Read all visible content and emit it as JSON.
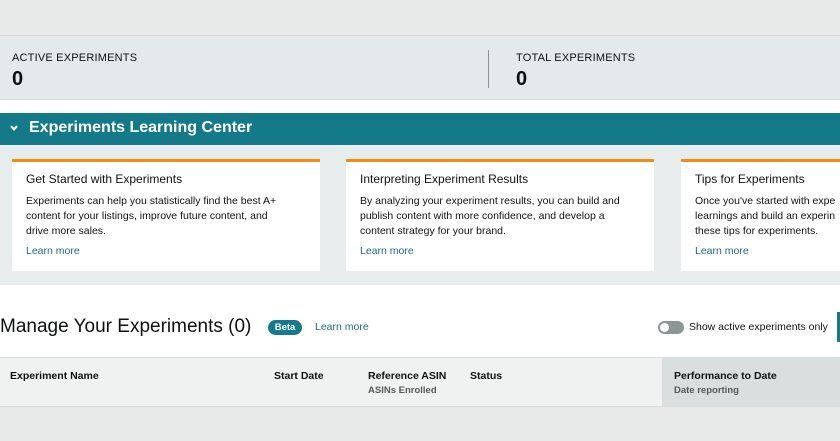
{
  "stats": {
    "active_label": "ACTIVE EXPERIMENTS",
    "active_value": "0",
    "total_label": "TOTAL EXPERIMENTS",
    "total_value": "0"
  },
  "learning_center": {
    "title": "Experiments Learning Center",
    "chevron_icon": "chevron-down-icon",
    "cards": [
      {
        "title": "Get Started with Experiments",
        "lines": [
          "Experiments can help you statistically find the best A+",
          "content for your listings, improve future content, and",
          "drive more sales."
        ],
        "link": "Learn more"
      },
      {
        "title": "Interpreting Experiment Results",
        "lines": [
          "By analyzing your experiment results, you can build and",
          "publish content with more confidence, and develop a",
          "content strategy for your brand."
        ],
        "link": "Learn more"
      },
      {
        "title": "Tips for Experiments",
        "lines": [
          "Once you've started with expe",
          "learnings and build an experin",
          "these tips for experiments."
        ],
        "link": "Learn more"
      }
    ]
  },
  "manage": {
    "title": "Manage Your Experiments (0)",
    "badge": "Beta",
    "learn_more": "Learn more",
    "toggle_label": "Show active experiments only",
    "toggle_on": false
  },
  "table": {
    "columns": [
      {
        "label": "Experiment Name",
        "sub": ""
      },
      {
        "label": "Start Date",
        "sub": ""
      },
      {
        "label": "Reference ASIN",
        "sub": "ASINs Enrolled"
      },
      {
        "label": "Status",
        "sub": ""
      },
      {
        "label": "Performance to Date",
        "sub": "Date reporting"
      }
    ]
  },
  "colors": {
    "accent_teal": "#147a8a",
    "card_border_orange": "#f08c1a",
    "link": "#1a6d7d"
  }
}
